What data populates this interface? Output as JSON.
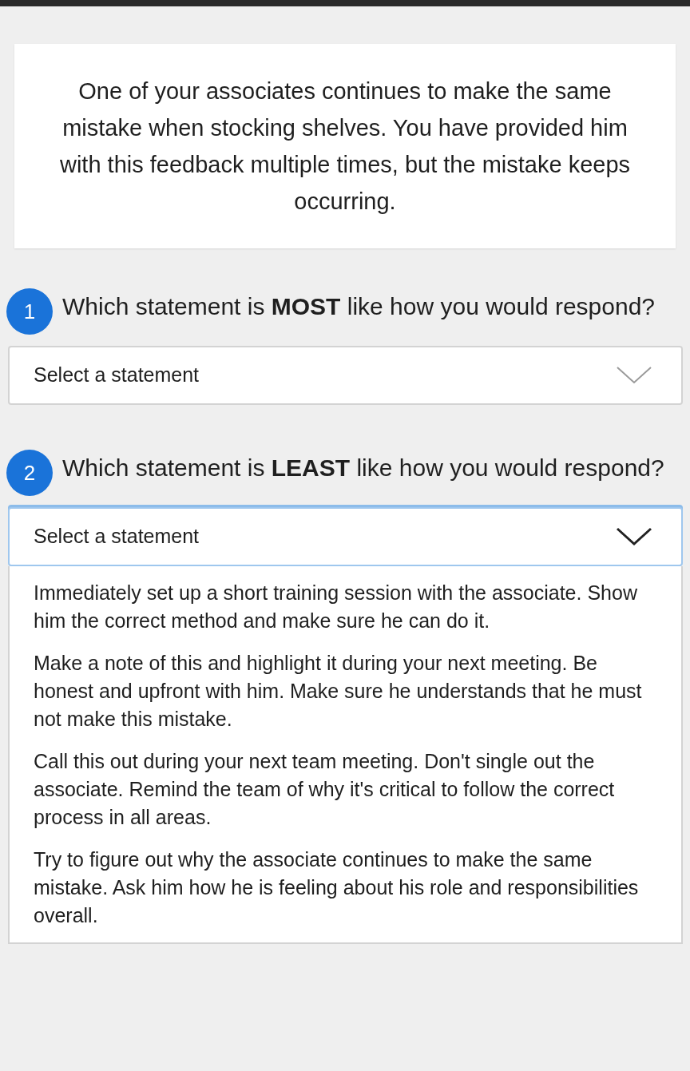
{
  "scenario": "One of your associates continues to make the same mistake when stocking shelves. You have provided him with this feedback multiple times, but the mistake keeps occurring.",
  "questions": [
    {
      "number": "1",
      "text": "Which statement is **MOST** like how you would respond?",
      "dropdown": {
        "placeholder": "Select a statement",
        "expanded": false
      }
    },
    {
      "number": "2",
      "text": "Which statement is **LEAST** like how you would respond?",
      "dropdown": {
        "placeholder": "Select a statement",
        "expanded": true,
        "options": [
          "Immediately set up a short training session with the associate. Show him the correct method and make sure he can do it.",
          "Make a note of this and highlight it during your next meeting. Be honest and upfront with him. Make sure he understands that he must not make this mistake.",
          "Call this out during your next team meeting. Don't single out the associate. Remind the team of why it's critical to follow the correct process in all areas.",
          "Try to figure out why the associate continues to make the same mistake. Ask him how he is feeling about his role and responsibilities overall."
        ]
      }
    }
  ]
}
